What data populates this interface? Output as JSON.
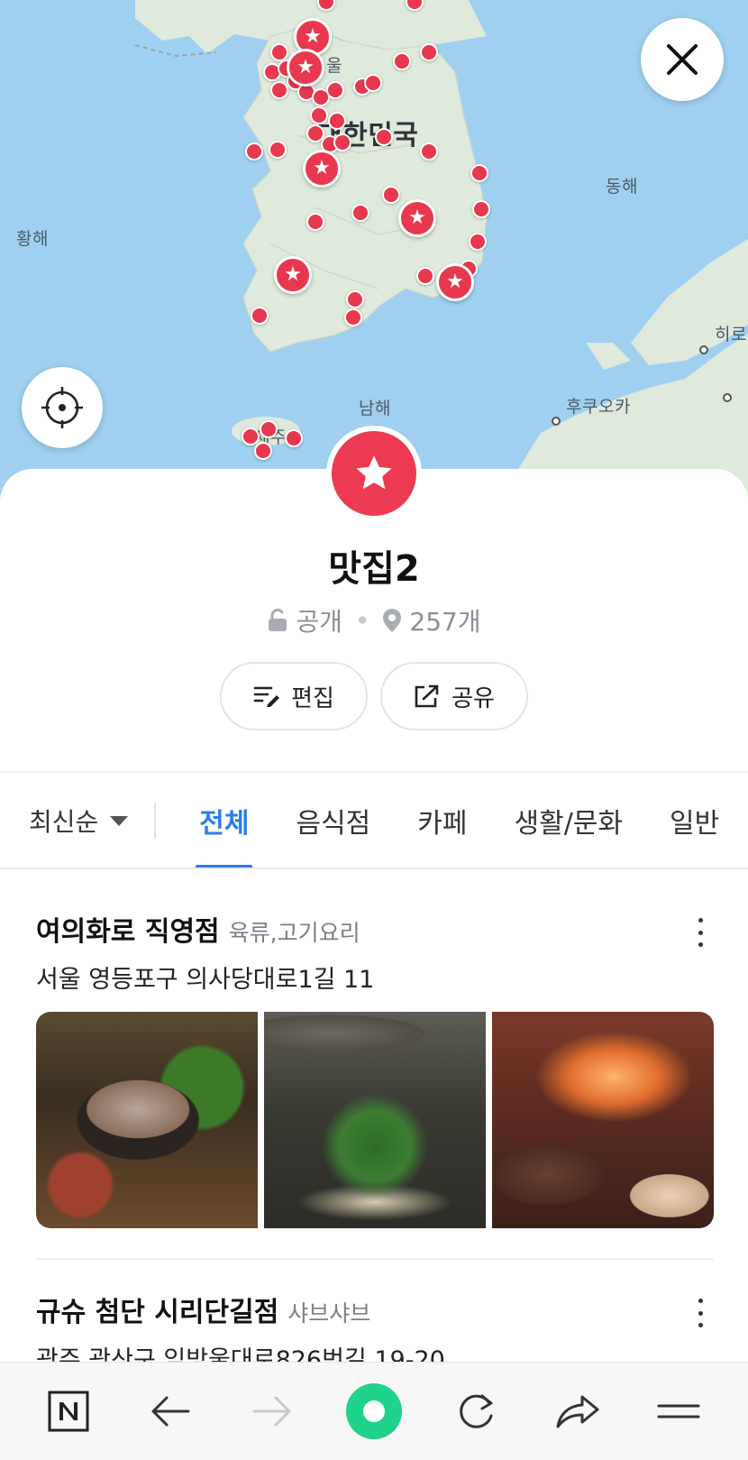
{
  "map": {
    "labels": {
      "seoul": "울",
      "korea": "대한민국",
      "east_sea": "동해",
      "yellow_sea": "황해",
      "south_sea": "남해",
      "fukuoka": "후쿠오카",
      "hiro": "히로",
      "jeju": "제주"
    },
    "pin_color": "#e8384f"
  },
  "controls": {
    "close_icon": "close-icon",
    "locate_icon": "crosshair-icon"
  },
  "folder": {
    "title": "맛집2",
    "visibility": "공개",
    "count": "257개",
    "icon": "star-icon",
    "color": "#ec3a52"
  },
  "actions": {
    "edit_label": "편집",
    "share_label": "공유"
  },
  "filter": {
    "sort_label": "최신순",
    "tabs": [
      "전체",
      "음식점",
      "카페",
      "생활/문화",
      "일반"
    ],
    "active_tab": "전체",
    "accent": "#2b7de9"
  },
  "places": [
    {
      "name": "여의화로 직영점",
      "category": "육류,고기요리",
      "address": "서울 영등포구 의사당대로1길 11"
    },
    {
      "name": "규슈 첨단 시리단길점",
      "category": "샤브샤브",
      "address": "광주 광산구 임방울대로826번길 19-20"
    }
  ],
  "browser_bar": {
    "items": [
      "naver-home-icon",
      "back-icon",
      "forward-icon",
      "green-dot-icon",
      "reload-icon",
      "share-icon",
      "menu-icon"
    ]
  }
}
